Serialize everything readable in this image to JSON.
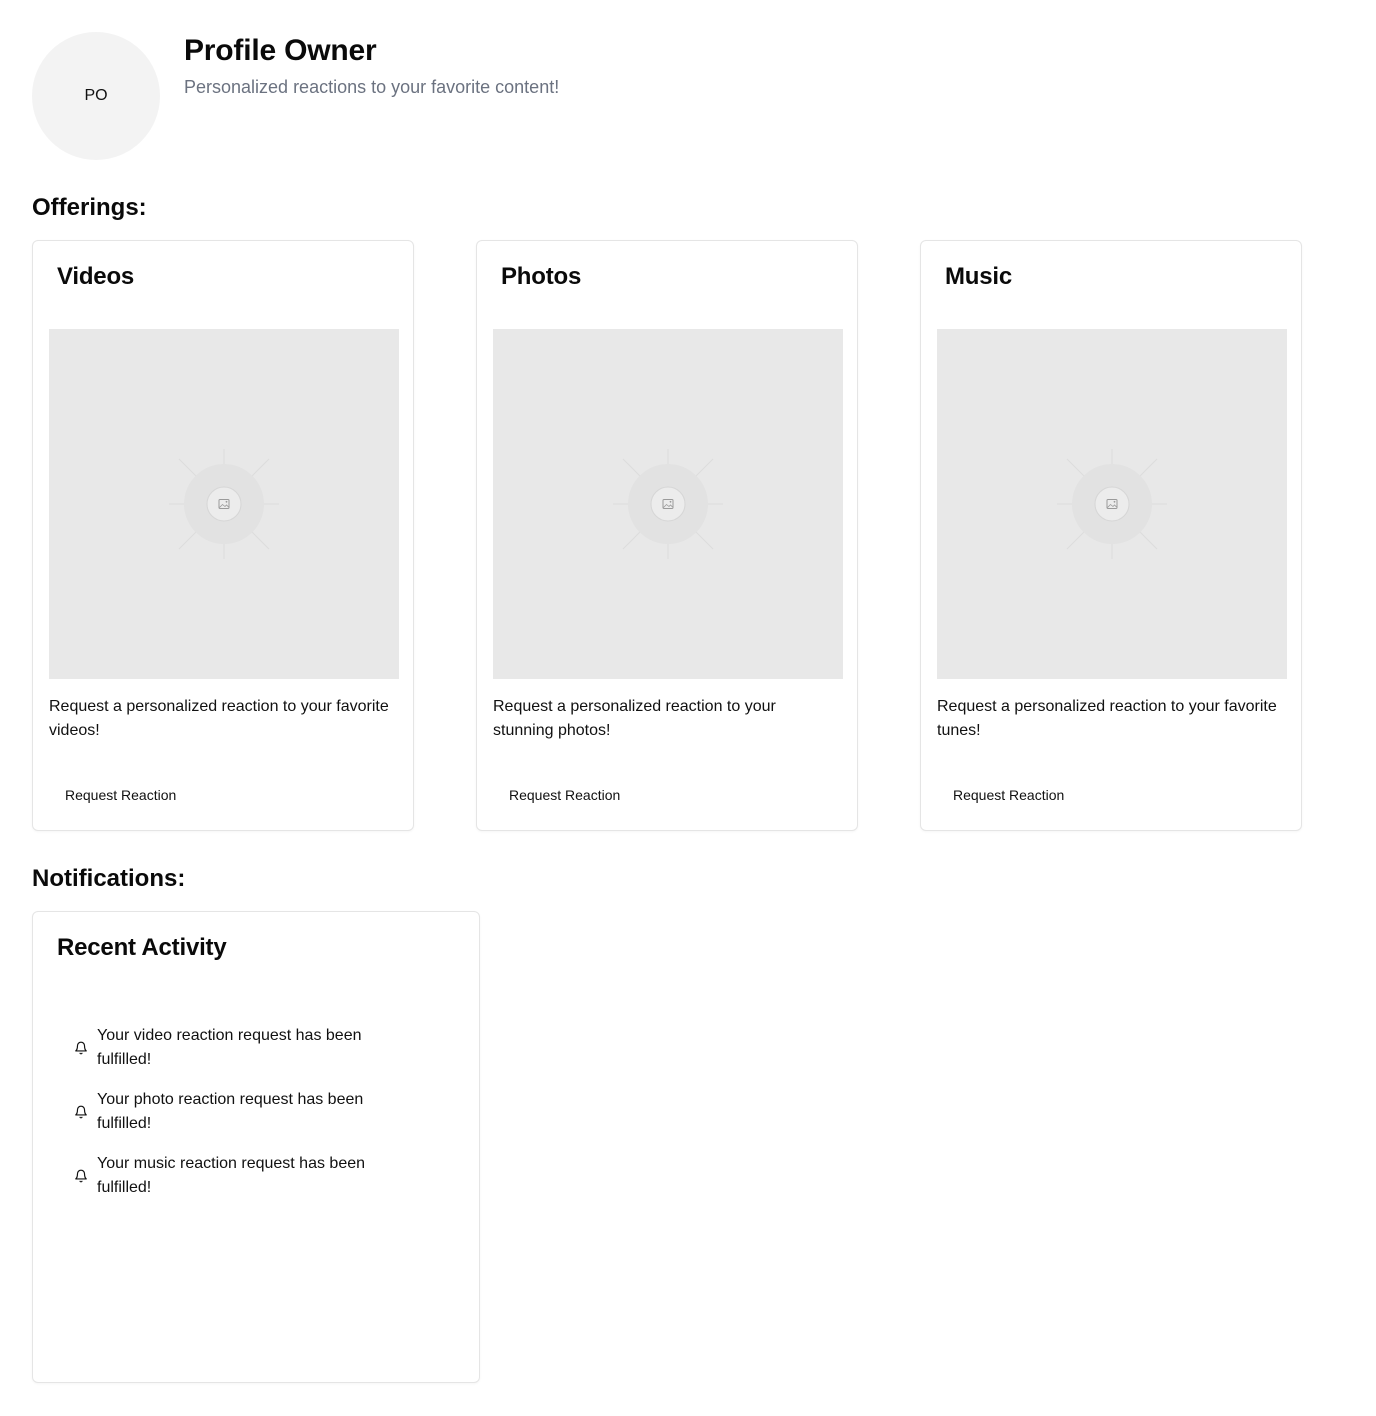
{
  "profile": {
    "avatar_initials": "PO",
    "name": "Profile Owner",
    "tagline": "Personalized reactions to your favorite content!"
  },
  "offerings": {
    "heading": "Offerings:",
    "cards": [
      {
        "title": "Videos",
        "description": "Request a personalized reaction to your favorite videos!",
        "button_label": "Request Reaction",
        "image_icon": "image-placeholder-icon"
      },
      {
        "title": "Photos",
        "description": "Request a personalized reaction to your stunning photos!",
        "button_label": "Request Reaction",
        "image_icon": "image-placeholder-icon"
      },
      {
        "title": "Music",
        "description": "Request a personalized reaction to your favorite tunes!",
        "button_label": "Request Reaction",
        "image_icon": "image-placeholder-icon"
      }
    ]
  },
  "notifications": {
    "heading": "Notifications:",
    "card_title": "Recent Activity",
    "items": [
      {
        "icon": "bell-icon",
        "text": "Your video reaction request has been fulfilled!"
      },
      {
        "icon": "bell-icon",
        "text": "Your photo reaction request has been fulfilled!"
      },
      {
        "icon": "bell-icon",
        "text": "Your music reaction request has been fulfilled!"
      }
    ]
  },
  "colors": {
    "avatar_bg": "#f3f3f3",
    "placeholder_bg": "#e8e8e8",
    "muted_text": "#6b7280",
    "card_border": "#e5e5e5"
  }
}
